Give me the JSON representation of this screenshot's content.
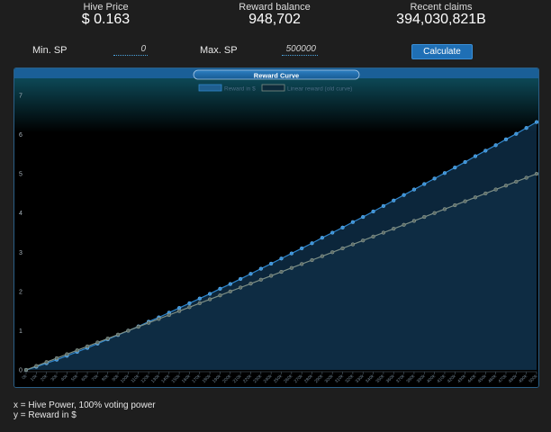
{
  "stats": {
    "price_label": "Hive Price",
    "price_value": "$ 0.163",
    "balance_label": "Reward balance",
    "balance_value": "948,702",
    "claims_label": "Recent claims",
    "claims_value": "394,030,821B"
  },
  "form": {
    "min_label": "Min. SP",
    "min_value": "0",
    "max_label": "Max. SP",
    "max_value": "500000",
    "calc_label": "Calculate"
  },
  "colors": {
    "accent": "#1f6fb5",
    "series_new": "#2f86cc",
    "series_old": "#7d8f86"
  },
  "chart_data": {
    "type": "line",
    "title": "Reward Curve",
    "ylim": [
      0,
      7
    ],
    "yticks": [
      0,
      1,
      2,
      3,
      4,
      5,
      6,
      7
    ],
    "x": [
      0,
      10000,
      20000,
      30000,
      40000,
      50000,
      60000,
      70000,
      80000,
      90000,
      100000,
      110000,
      120000,
      130000,
      140000,
      150000,
      160000,
      170000,
      180000,
      190000,
      200000,
      210000,
      220000,
      230000,
      240000,
      250000,
      260000,
      270000,
      280000,
      290000,
      300000,
      310000,
      320000,
      330000,
      340000,
      350000,
      360000,
      370000,
      380000,
      390000,
      400000,
      410000,
      420000,
      430000,
      440000,
      450000,
      460000,
      470000,
      480000,
      490000,
      500000
    ],
    "xtick_labels": [
      "0k",
      "10k",
      "20k",
      "30k",
      "40k",
      "50k",
      "60k",
      "70k",
      "80k",
      "90k",
      "100k",
      "110k",
      "120k",
      "130k",
      "140k",
      "150k",
      "160k",
      "170k",
      "180k",
      "190k",
      "200k",
      "210k",
      "220k",
      "230k",
      "240k",
      "250k",
      "260k",
      "270k",
      "280k",
      "290k",
      "300k",
      "310k",
      "320k",
      "330k",
      "340k",
      "350k",
      "360k",
      "370k",
      "380k",
      "390k",
      "400k",
      "410k",
      "420k",
      "430k",
      "440k",
      "450k",
      "460k",
      "470k",
      "480k",
      "490k",
      "500k"
    ],
    "series": [
      {
        "name": "Reward in $",
        "values": [
          0,
          0.08,
          0.17,
          0.26,
          0.36,
          0.46,
          0.56,
          0.67,
          0.78,
          0.89,
          1.0,
          1.11,
          1.23,
          1.34,
          1.46,
          1.58,
          1.7,
          1.82,
          1.94,
          2.07,
          2.19,
          2.32,
          2.45,
          2.58,
          2.71,
          2.84,
          2.97,
          3.1,
          3.23,
          3.37,
          3.5,
          3.63,
          3.77,
          3.9,
          4.04,
          4.18,
          4.32,
          4.46,
          4.6,
          4.74,
          4.88,
          5.02,
          5.16,
          5.3,
          5.45,
          5.59,
          5.73,
          5.88,
          6.02,
          6.17,
          6.32
        ]
      },
      {
        "name": "Linear reward (old curve)",
        "values": [
          0,
          0.1,
          0.2,
          0.3,
          0.4,
          0.5,
          0.6,
          0.7,
          0.8,
          0.9,
          1.0,
          1.1,
          1.2,
          1.3,
          1.4,
          1.5,
          1.6,
          1.7,
          1.8,
          1.9,
          2.0,
          2.1,
          2.2,
          2.3,
          2.4,
          2.5,
          2.6,
          2.7,
          2.8,
          2.9,
          3.0,
          3.1,
          3.2,
          3.3,
          3.4,
          3.5,
          3.6,
          3.7,
          3.8,
          3.9,
          4.0,
          4.1,
          4.2,
          4.3,
          4.4,
          4.5,
          4.6,
          4.7,
          4.8,
          4.9,
          5.0
        ]
      }
    ],
    "legend_position": "top-center"
  },
  "footnotes": {
    "x_note": "x = Hive Power, 100% voting power",
    "y_note": "y = Reward in $"
  }
}
